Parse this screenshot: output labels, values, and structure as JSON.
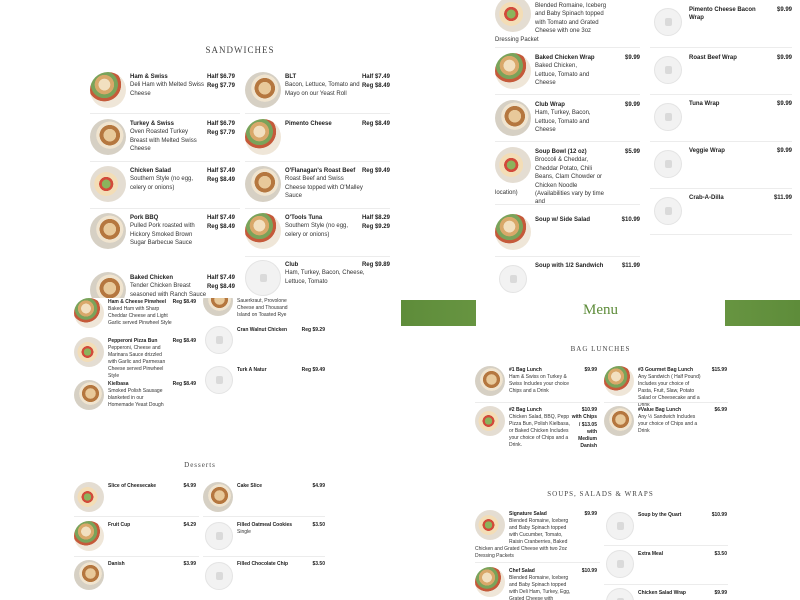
{
  "sandwiches": {
    "title": "SANDWICHES",
    "items": [
      {
        "name": "Ham & Swiss",
        "desc": "Deli Ham with Melted Swiss Cheese",
        "half": "Half $6.79",
        "reg": "Reg $7.79"
      },
      {
        "name": "BLT",
        "desc": "Bacon, Lettuce, Tomato and Mayo on our Yeast Roll",
        "half": "Half $7.49",
        "reg": "Reg $8.49"
      },
      {
        "name": "Turkey & Swiss",
        "desc": "Oven Roasted Turkey Breast with Melted Swiss Cheese",
        "half": "Half $6.79",
        "reg": "Reg $7.79"
      },
      {
        "name": "Pimento Cheese",
        "desc": "",
        "half": "",
        "reg": "Reg $8.49"
      },
      {
        "name": "Chicken Salad",
        "desc": "Southern Style (no egg, celery or onions)",
        "half": "Half $7.49",
        "reg": "Reg $8.49"
      },
      {
        "name": "O'Flanagan's Roast Beef",
        "desc": "Roast Beef and Swiss Cheese topped with O'Malley Sauce",
        "half": "",
        "reg": "Reg $9.49"
      },
      {
        "name": "Pork BBQ",
        "desc": "Pulled Pork roasted with Hickory Smoked Brown Sugar Barbecue Sauce",
        "half": "Half $7.49",
        "reg": "Reg $8.49"
      },
      {
        "name": "O'Tools Tuna",
        "desc": "Southern Style (no egg, celery or onions)",
        "half": "Half $8.29",
        "reg": "Reg $9.29"
      },
      {
        "name": "Baked Chicken",
        "desc": "Tender Chicken Breast seasoned with Ranch Sauce",
        "half": "Half $7.49",
        "reg": "Reg $8.49"
      },
      {
        "name": "Club",
        "desc": "Ham, Turkey, Bacon, Cheese, Lettuce, Tomato",
        "half": "",
        "reg": "Reg $9.89"
      }
    ]
  },
  "wraps": {
    "top_desc": "Blended Romaine, Iceberg and Baby Spinach topped with Tomato and Grated Cheese with one 3oz",
    "top_desc2": "Dressing Packet",
    "left": [
      {
        "name": "Baked Chicken Wrap",
        "desc": "Baked Chicken, Lettuce, Tomato and Cheese",
        "price": "$9.99"
      },
      {
        "name": "Club Wrap",
        "desc": "Ham, Turkey, Bacon, Lettuce, Tomato and Cheese",
        "price": "$9.99"
      },
      {
        "name": "Soup Bowl (12 oz)",
        "desc": "Broccoli & Cheddar, Cheddar Potato, Chili Beans, Clam Chowder or Chicken Noodle (Availabilities vary by time and",
        "desc2": "location)",
        "price": "$5.99"
      },
      {
        "name": "Soup w/ Side Salad",
        "desc": "",
        "price": "$10.99"
      },
      {
        "name": "Soup with 1/2 Sandwich",
        "desc": "",
        "price": "$11.99"
      }
    ],
    "right": [
      {
        "name": "Pimento Cheese Bacon Wrap",
        "price": "$9.99"
      },
      {
        "name": "Roast Beef Wrap",
        "price": "$9.99"
      },
      {
        "name": "Tuna Wrap",
        "price": "$9.99"
      },
      {
        "name": "Veggie Wrap",
        "price": "$9.99"
      },
      {
        "name": "Crab-A-Dilla",
        "price": "$11.99"
      }
    ]
  },
  "lower_left": {
    "partial_desc": "Sauerkraut, Provolone Cheese and Thousand Island on Toasted Rye",
    "items": [
      {
        "name": "Ham & Cheese Pinwheel",
        "desc": "Baked Ham with Sharp Cheddar Cheese and Light Garlic served Pinwheel Style",
        "price": "Reg $8.49"
      },
      {
        "name": "Pepperoni Pizza Bun",
        "desc": "Pepperoni, Cheese and Marinara Sauce drizzled with Garlic and Parmesan Cheese served Pinwheel Style",
        "price": "Reg $8.49"
      },
      {
        "name": "Kielbasa",
        "desc": "Smoked Polish Sausage blanketed in our Homemade Yeast Dough",
        "price": "Reg $8.49"
      }
    ],
    "right_items": [
      {
        "name": "Cran Walnut Chicken",
        "price": "Reg $9.29"
      },
      {
        "name": "Turk A Natur",
        "price": "Reg $9.49"
      }
    ]
  },
  "desserts": {
    "title": "Desserts",
    "items": [
      {
        "name": "Slice of Cheesecake",
        "price": "$4.99"
      },
      {
        "name": "Cake Slice",
        "price": "$4.99"
      },
      {
        "name": "Fruit Cup",
        "price": "$4.29"
      },
      {
        "name": "Filled Oatmeal Cookies",
        "desc": "Single",
        "price": "$3.50"
      },
      {
        "name": "Danish",
        "price": "$3.99"
      },
      {
        "name": "Filled Chocolate Chip",
        "price": "$3.50"
      }
    ]
  },
  "menu_banner": {
    "title": "Menu"
  },
  "bag_lunches": {
    "title": "BAG LUNCHES",
    "items": [
      {
        "name": "#1 Bag Lunch",
        "desc": "Ham & Swiss on Turkey & Swiss Includes your choice Chips and a Drink",
        "price": "$9.99"
      },
      {
        "name": "#3 Gourmet Bag Lunch",
        "desc": "Any Sandwich ( Half Pound) Includes your choice of Pasta, Fruit, Slaw, Potato Salad or Cheesecake and a Drink",
        "price": "$15.99"
      },
      {
        "name": "#2 Bag Lunch",
        "desc": "Chicken Salad, BBQ, Pepp Pizza Bun, Polish Kielbasa, or Baked Chicken Includes your choice of Chips and a Drink.",
        "price": "$10.99 with Chips / $13.05 with Medium Danish"
      },
      {
        "name": "#Value Bag Lunch",
        "desc": "Any ½ Sandwich Includes your choice of Chips and a Drink",
        "price": "$6.99"
      }
    ]
  },
  "soups_salads": {
    "title": "SOUPS, SALADS & WRAPS",
    "left": [
      {
        "name": "Signature Salad",
        "desc": "Blended Romaine, Iceberg and Baby Spinach topped with Cucumber, Tomato, Raisin Cranberries, Baked",
        "desc2": "Chicken and Grated Cheese with two 2oz Dressing Packets",
        "price": "$9.99"
      },
      {
        "name": "Chef Salad",
        "desc": "Blended Romaine, Iceberg and Baby Spinach topped with Deli Ham, Turkey, Egg, Grated Cheese with",
        "price": "$10.99"
      }
    ],
    "right": [
      {
        "name": "Soup by the Quart",
        "price": "$10.99"
      },
      {
        "name": "Extra Meal",
        "price": "$3.50"
      },
      {
        "name": "Chicken Salad Wrap",
        "price": "$9.99"
      }
    ]
  }
}
